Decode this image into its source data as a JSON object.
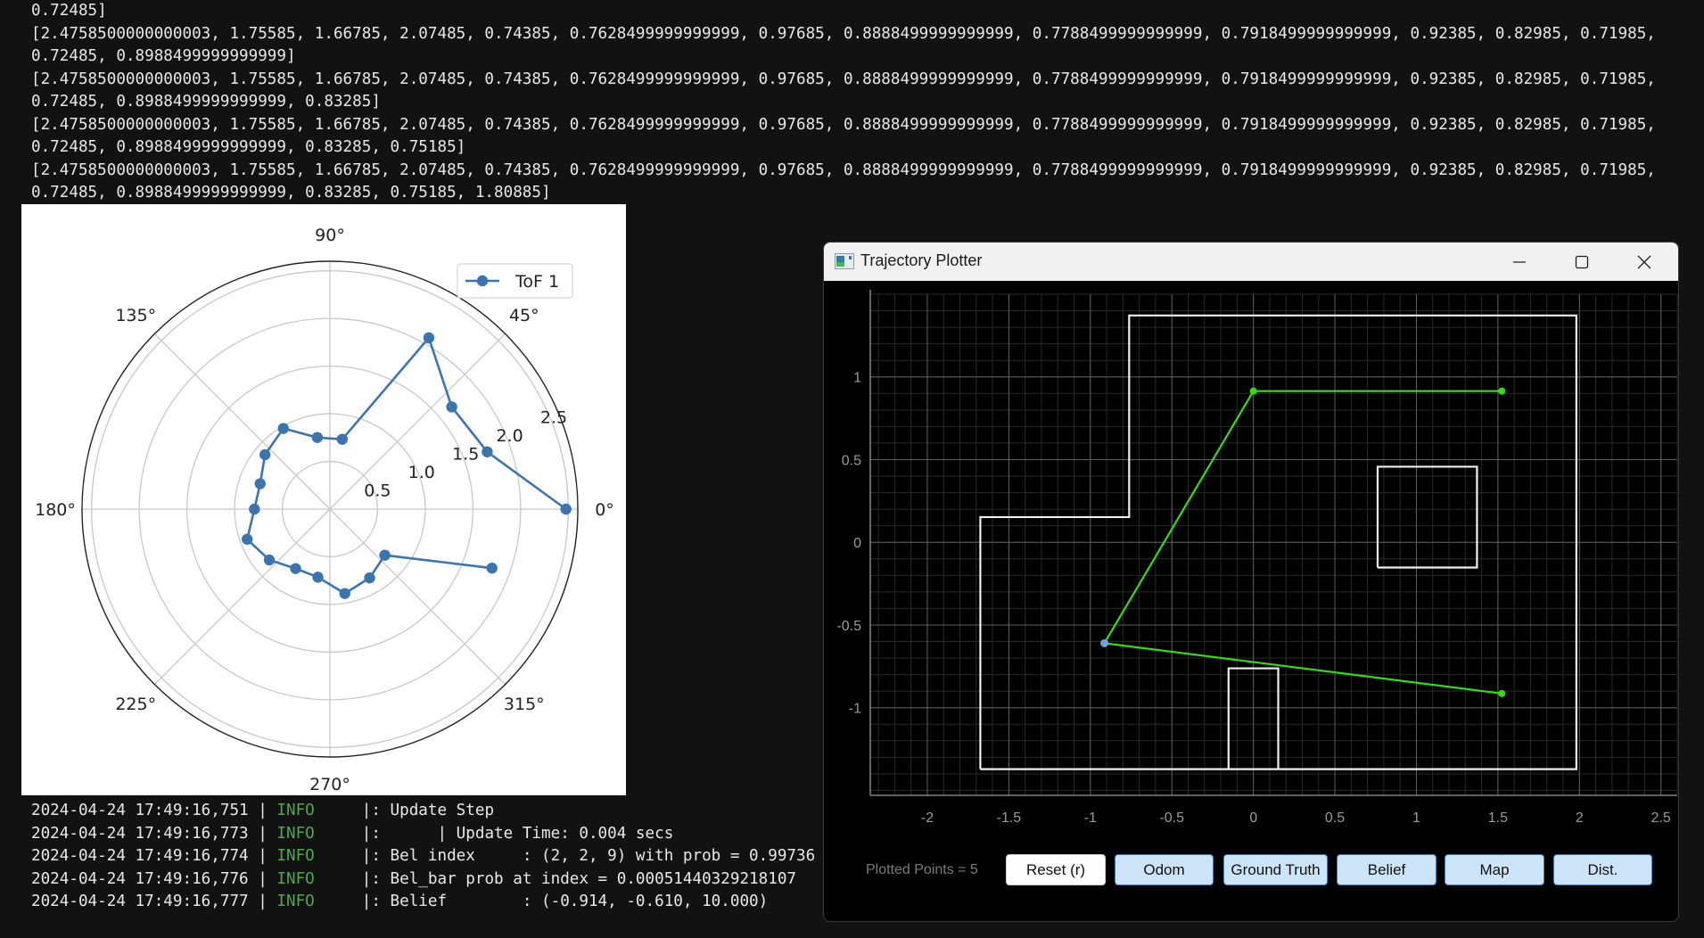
{
  "terminal": {
    "lines": [
      "0.72485]",
      "[2.4758500000000003, 1.75585, 1.66785, 2.07485, 0.74385, 0.7628499999999999, 0.97685, 0.8888499999999999, 0.7788499999999999, 0.7918499999999999, 0.92385, 0.82985, 0.71985,",
      "0.72485, 0.8988499999999999]",
      "[2.4758500000000003, 1.75585, 1.66785, 2.07485, 0.74385, 0.7628499999999999, 0.97685, 0.8888499999999999, 0.7788499999999999, 0.7918499999999999, 0.92385, 0.82985, 0.71985,",
      "0.72485, 0.8988499999999999, 0.83285]",
      "[2.4758500000000003, 1.75585, 1.66785, 2.07485, 0.74385, 0.7628499999999999, 0.97685, 0.8888499999999999, 0.7788499999999999, 0.7918499999999999, 0.92385, 0.82985, 0.71985,",
      "0.72485, 0.8988499999999999, 0.83285, 0.75185]",
      "[2.4758500000000003, 1.75585, 1.66785, 2.07485, 0.74385, 0.7628499999999999, 0.97685, 0.8888499999999999, 0.7788499999999999, 0.7918499999999999, 0.92385, 0.82985, 0.71985,",
      "0.72485, 0.8988499999999999, 0.83285, 0.75185, 1.80885]"
    ],
    "logs": [
      {
        "time": "2024-04-24 17:49:16,751",
        "level": "INFO",
        "message": "|: Update Step"
      },
      {
        "time": "2024-04-24 17:49:16,773",
        "level": "INFO",
        "message": "|:      | Update Time: 0.004 secs"
      },
      {
        "time": "2024-04-24 17:49:16,774",
        "level": "INFO",
        "message": "|: Bel index     : (2, 2, 9) with prob = 0.99736"
      },
      {
        "time": "2024-04-24 17:49:16,776",
        "level": "INFO",
        "message": "|: Bel_bar prob at index = 0.00051440329218107"
      },
      {
        "time": "2024-04-24 17:49:16,777",
        "level": "INFO",
        "message": "|: Belief        : (-0.914, -0.610, 10.000)"
      }
    ]
  },
  "chart_data": [
    {
      "type": "polar-line",
      "title": "",
      "theta_deg": [
        0,
        20,
        40,
        60,
        80,
        100,
        120,
        140,
        160,
        180,
        200,
        220,
        240,
        260,
        280,
        300,
        320,
        340
      ],
      "series": [
        {
          "name": "ToF 1",
          "color": "#3a75b0",
          "values": [
            2.4758500000000003,
            1.75585,
            1.66785,
            2.07485,
            0.74385,
            0.7628499999999999,
            0.97685,
            0.8888499999999999,
            0.7788499999999999,
            0.7918499999999999,
            0.92385,
            0.82985,
            0.71985,
            0.72485,
            0.8988499999999999,
            0.83285,
            0.75185,
            1.80885
          ]
        }
      ],
      "angle_ticks": [
        "0°",
        "45°",
        "90°",
        "135°",
        "180°",
        "225°",
        "270°",
        "315°"
      ],
      "radial_ticks": [
        "0.5",
        "1.0",
        "1.5",
        "2.0",
        "2.5"
      ],
      "radial_tick_values": [
        0.5,
        1.0,
        1.5,
        2.0,
        2.5
      ],
      "rlim": [
        0,
        2.6
      ],
      "grid": true,
      "legend": "top-right"
    },
    {
      "type": "line",
      "title": "Trajectory Plotter",
      "xlim": [
        -2.35,
        2.6
      ],
      "ylim": [
        -1.53,
        1.5
      ],
      "x_ticks": [
        "-2",
        "-1.5",
        "-1",
        "-0.5",
        "0",
        "0.5",
        "1",
        "1.5",
        "2",
        "2.5"
      ],
      "x_tick_values": [
        -2,
        -1.5,
        -1,
        -0.5,
        0,
        0.5,
        1,
        1.5,
        2,
        2.5
      ],
      "y_ticks": [
        "1",
        "0.5",
        "0",
        "-0.5",
        "-1"
      ],
      "y_tick_values": [
        1,
        0.5,
        0,
        -0.5,
        -1
      ],
      "grid": true,
      "map_walls": [
        [
          [
            -1.675,
            -1.3716
          ],
          [
            1.9812,
            -1.3716
          ],
          [
            1.9812,
            1.3716
          ],
          [
            -0.762,
            1.3716
          ],
          [
            -0.762,
            0.1524
          ],
          [
            -1.675,
            0.1524
          ],
          [
            -1.675,
            -1.3716
          ]
        ],
        [
          [
            0.762,
            -0.1524
          ],
          [
            1.3716,
            -0.1524
          ],
          [
            1.3716,
            0.4572
          ],
          [
            0.762,
            0.4572
          ],
          [
            0.762,
            -0.1524
          ]
        ],
        [
          [
            -0.1524,
            -1.3716
          ],
          [
            -0.1524,
            -0.762
          ],
          [
            0.1524,
            -0.762
          ],
          [
            0.1524,
            -1.3716
          ]
        ]
      ],
      "series": [
        {
          "name": "Ground Truth",
          "color": "#33dd11",
          "points": [
            [
              1.524,
              0.9144
            ],
            [
              0.0,
              0.9144
            ],
            [
              -0.914,
              -0.61
            ],
            [
              1.524,
              -0.9144
            ]
          ]
        },
        {
          "name": "Belief",
          "color": "#6fa3d8",
          "points": [
            [
              -0.914,
              -0.61
            ]
          ]
        }
      ]
    }
  ],
  "trajectory_window": {
    "title": "Trajectory Plotter",
    "icons": {
      "app": "chart-app-icon",
      "minimize": "minimize-icon",
      "maximize": "maximize-icon",
      "close": "close-icon"
    },
    "plotted_points_label": "Plotted Points = 5",
    "buttons": [
      {
        "label": "Reset (r)",
        "style": "white"
      },
      {
        "label": "Odom",
        "style": "blue"
      },
      {
        "label": "Ground Truth",
        "style": "blue"
      },
      {
        "label": "Belief",
        "style": "blue"
      },
      {
        "label": "Map",
        "style": "blue"
      },
      {
        "label": "Dist.",
        "style": "blue"
      }
    ]
  },
  "colors": {
    "terminal_bg": "#121212",
    "info_green": "#4ea84e",
    "button_blue": "#cce4f7",
    "trajectory_green": "#33dd11",
    "belief_blue": "#6fa3d8",
    "tof_blue": "#3a75b0"
  }
}
